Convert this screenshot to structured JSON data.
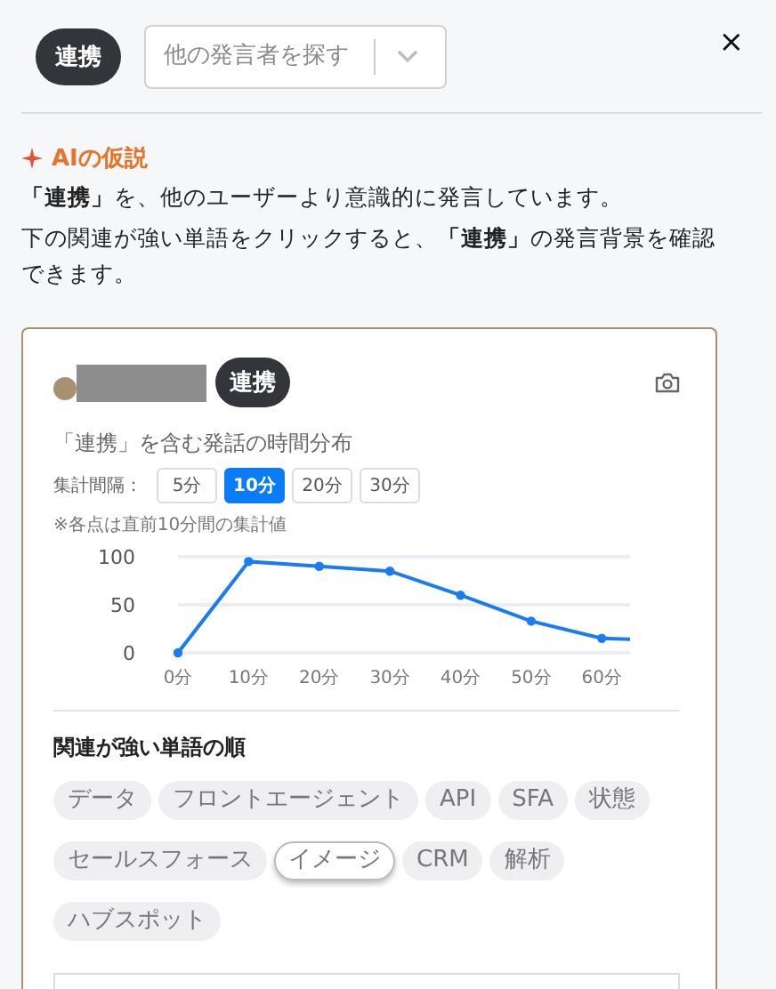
{
  "header": {
    "keyword": "連携",
    "speaker_select": {
      "placeholder": "他の発言者を探す"
    },
    "close": "×"
  },
  "ai_hypothesis": {
    "title": "AIの仮説",
    "lines": [
      "**「連携」**を、他のユーザーより意識的に発言しています。",
      "下の関連が強い単語をクリックすると、**「連携」**の発言背景を確認できます。"
    ]
  },
  "card": {
    "keyword": "連携",
    "chart_title": "「連携」を含む発話の時間分布",
    "interval_label": "集計間隔：",
    "intervals": [
      {
        "label": "5分",
        "selected": false
      },
      {
        "label": "10分",
        "selected": true
      },
      {
        "label": "20分",
        "selected": false
      },
      {
        "label": "30分",
        "selected": false
      }
    ],
    "note": "※各点は直前10分間の集計値",
    "chart_data": {
      "type": "line",
      "x": [
        0,
        10,
        20,
        30,
        40,
        50,
        60,
        64
      ],
      "xlim": [
        0,
        64
      ],
      "ylim": [
        0,
        100
      ],
      "xticks": [
        {
          "value": 0,
          "label": "0分"
        },
        {
          "value": 10,
          "label": "10分"
        },
        {
          "value": 20,
          "label": "20分"
        },
        {
          "value": 30,
          "label": "30分"
        },
        {
          "value": 40,
          "label": "40分"
        },
        {
          "value": 50,
          "label": "50分"
        },
        {
          "value": 60,
          "label": "60分"
        }
      ],
      "yticks": [
        0,
        50,
        100
      ],
      "series": [
        {
          "color": "#1a7cf0",
          "marker": "circle",
          "values": [
            0,
            95,
            90,
            85,
            60,
            33,
            15,
            14
          ]
        }
      ]
    },
    "related_title": "関連が強い単語の順",
    "words": [
      {
        "label": "データ",
        "selected": false
      },
      {
        "label": "フロントエージェント",
        "selected": false
      },
      {
        "label": "API",
        "selected": false
      },
      {
        "label": "SFA",
        "selected": false
      },
      {
        "label": "状態",
        "selected": false
      },
      {
        "label": "セールスフォース",
        "selected": false
      },
      {
        "label": "イメージ",
        "selected": true
      },
      {
        "label": "CRM",
        "selected": false
      },
      {
        "label": "解析",
        "selected": false
      },
      {
        "label": "ハブスポット",
        "selected": false
      }
    ]
  }
}
